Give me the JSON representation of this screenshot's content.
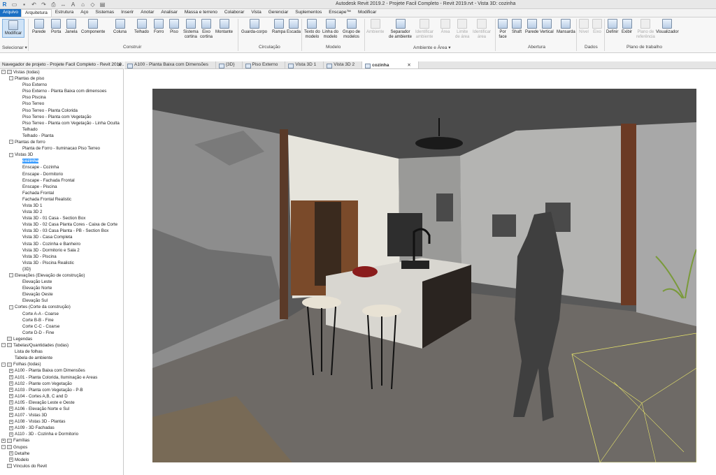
{
  "window": {
    "title": "Autodesk Revit 2019.2 - Projete Facil Completo - Revit 2019.rvt - Vista 3D: cozinha"
  },
  "menu": [
    "Arquivo",
    "Arquitetura",
    "Estrutura",
    "Aço",
    "Sistemas",
    "Inserir",
    "Anotar",
    "Analisar",
    "Massa e terreno",
    "Colaborar",
    "Vista",
    "Gerenciar",
    "Suplementos",
    "Enscape™",
    "Modificar"
  ],
  "ribbon": {
    "tools": {
      "modificar": "Modificar",
      "parede": "Parede",
      "porta": "Porta",
      "janela": "Janela",
      "componente": "Componente",
      "coluna": "Coluna",
      "telhado": "Telhado",
      "forro": "Forro",
      "piso": "Piso",
      "sistema_cortina": "Sistema\ncortina",
      "eixo_cortina": "Eixo\ncortina",
      "montante": "Montante",
      "guarda_corpo": "Guarda-corpo",
      "rampa": "Rampa",
      "escada": "Escada",
      "texto_modelo": "Texto do\nmodelo",
      "linha_modelo": "Linha do\nmodelo",
      "grupo_modelos": "Grupo de\nmodelos",
      "ambiente": "Ambiente",
      "separador": "Separador\nde ambiente",
      "identificar_ambiente": "Identificar\nambiente",
      "area": "Área",
      "limite_area": "Limite\nde área",
      "identificar_area": "Identificar\nárea",
      "por_face": "Por\nface",
      "shaft": "Shaft",
      "parede_ab": "Parede",
      "vertical": "Vertical",
      "mansarda": "Mansarda",
      "nivel": "Nível",
      "eixo": "Eixo",
      "definir": "Definir",
      "exibir": "Exibir",
      "plano_ref": "Plano de\nreferência",
      "visualizador": "Visualizador"
    },
    "panels": {
      "selecionar": "Selecionar ▾",
      "construir": "Construir",
      "circulacao": "Circulação",
      "modelo": "Modelo",
      "ambiente_area": "Ambiente e Área ▾",
      "abertura": "Abertura",
      "dados": "Dados",
      "plano_trabalho": "Plano de trabalho"
    }
  },
  "navigator": {
    "title": "Navegador de projeto - Projete Facil Completo - Revit 2019....",
    "close": "✕"
  },
  "tree": [
    {
      "l": 0,
      "t": "Vistas (todas)",
      "e": "-",
      "i": true
    },
    {
      "l": 1,
      "t": "Plantas de piso",
      "e": "-"
    },
    {
      "l": 2,
      "t": "Piso Externo"
    },
    {
      "l": 2,
      "t": "Piso Externo - Planta Baixa com dimensoes"
    },
    {
      "l": 2,
      "t": "Piso Piscina"
    },
    {
      "l": 2,
      "t": "Piso Terreo"
    },
    {
      "l": 2,
      "t": "Piso Terreo - Planta Colorida"
    },
    {
      "l": 2,
      "t": "Piso Terreo - Planta com Vegetação"
    },
    {
      "l": 2,
      "t": "Piso Terreo - Planta com Vegetação - Linha Oculta"
    },
    {
      "l": 2,
      "t": "Telhado"
    },
    {
      "l": 2,
      "t": "Telhado - Planta"
    },
    {
      "l": 1,
      "t": "Plantas de forro",
      "e": "-"
    },
    {
      "l": 2,
      "t": "Planta de Forro - Iluminacao Piso Terreo"
    },
    {
      "l": 1,
      "t": "Vistas 3D",
      "e": "-"
    },
    {
      "l": 2,
      "t": "cozinha",
      "s": true
    },
    {
      "l": 2,
      "t": "Enscape - Cozinha"
    },
    {
      "l": 2,
      "t": "Enscape - Dormitorio"
    },
    {
      "l": 2,
      "t": "Enscape - Fachada Frontal"
    },
    {
      "l": 2,
      "t": "Enscape - Piscina"
    },
    {
      "l": 2,
      "t": "Fachada Frontal"
    },
    {
      "l": 2,
      "t": "Fachada Frontal Realistic"
    },
    {
      "l": 2,
      "t": "Vista 3D 1"
    },
    {
      "l": 2,
      "t": "Vista 3D 2"
    },
    {
      "l": 2,
      "t": "Vista 3D - 01 Casa - Section Box"
    },
    {
      "l": 2,
      "t": "Vista 3D - 02 Casa Planta Cores - Caixa de Corte"
    },
    {
      "l": 2,
      "t": "Vista 3D - 03 Casa Planta - PB - Section Box"
    },
    {
      "l": 2,
      "t": "Vista 3D - Casa Completa"
    },
    {
      "l": 2,
      "t": "Vista 3D - Cozinha e Banheiro"
    },
    {
      "l": 2,
      "t": "Vista 3D - Dormitorio e Sala 2"
    },
    {
      "l": 2,
      "t": "Vista 3D - Piscina"
    },
    {
      "l": 2,
      "t": "Vista 3D - Piscina  Realistic"
    },
    {
      "l": 2,
      "t": "{3D}"
    },
    {
      "l": 1,
      "t": "Elevações (Elevação de construção)",
      "e": "-"
    },
    {
      "l": 2,
      "t": "Elevação Leste"
    },
    {
      "l": 2,
      "t": "Elevação Norte"
    },
    {
      "l": 2,
      "t": "Elevação Oeste"
    },
    {
      "l": 2,
      "t": "Elevação Sul"
    },
    {
      "l": 1,
      "t": "Cortes (Corte da construção)",
      "e": "-"
    },
    {
      "l": 2,
      "t": "Corte A-A - Coarse"
    },
    {
      "l": 2,
      "t": "Corte B-B - Fine"
    },
    {
      "l": 2,
      "t": "Corte C-C - Coarse"
    },
    {
      "l": 2,
      "t": "Corte D-D - Fine"
    },
    {
      "l": 0,
      "t": "Legendas",
      "i": true
    },
    {
      "l": 0,
      "t": "Tabelas/Quantidades (todas)",
      "e": "-",
      "i": true
    },
    {
      "l": 1,
      "t": "Lista de folhas"
    },
    {
      "l": 1,
      "t": "Tabela de ambiente"
    },
    {
      "l": 0,
      "t": "Folhas (todas)",
      "e": "-",
      "i": true
    },
    {
      "l": 1,
      "t": "A100 - Planta Baixa com Dimensões",
      "e": "+"
    },
    {
      "l": 1,
      "t": "A101 - Planta Colorida, Iluminação e Areas",
      "e": "+"
    },
    {
      "l": 1,
      "t": "A102 - Plante com Vegetação",
      "e": "+"
    },
    {
      "l": 1,
      "t": "A103 - Planta com Vegetação - P-B",
      "e": "+"
    },
    {
      "l": 1,
      "t": "A104 - Cortes A,B, C and D",
      "e": "+"
    },
    {
      "l": 1,
      "t": "A105 - Elevação Leste e Oeste",
      "e": "+"
    },
    {
      "l": 1,
      "t": "A106 - Elevação Norte e Sul",
      "e": "+"
    },
    {
      "l": 1,
      "t": "A107 - Vistas 3D",
      "e": "+"
    },
    {
      "l": 1,
      "t": "A108 - Vistas 3D - Plantas",
      "e": "+"
    },
    {
      "l": 1,
      "t": "A109 - 3D Fachadas",
      "e": "+"
    },
    {
      "l": 1,
      "t": "A110 - 3D - Cozinha e Dormitorio",
      "e": "+"
    },
    {
      "l": 0,
      "t": "Famílias",
      "e": "+",
      "i": true
    },
    {
      "l": 0,
      "t": "Grupos",
      "e": "-",
      "i": true
    },
    {
      "l": 1,
      "t": "Detalhe",
      "e": "+"
    },
    {
      "l": 1,
      "t": "Modelo",
      "e": "+"
    },
    {
      "l": 0,
      "t": "Vínculos do Revit",
      "i": true
    }
  ],
  "tabs": [
    "A100 - Planta Baixa com Dimensões",
    "{3D}",
    "Piso Externo",
    "Vista 3D 1",
    "Vista 3D 2",
    "cozinha"
  ],
  "active_tab": "cozinha",
  "colors": {
    "accent": "#1a6fc4",
    "selection": "#3399ff"
  }
}
